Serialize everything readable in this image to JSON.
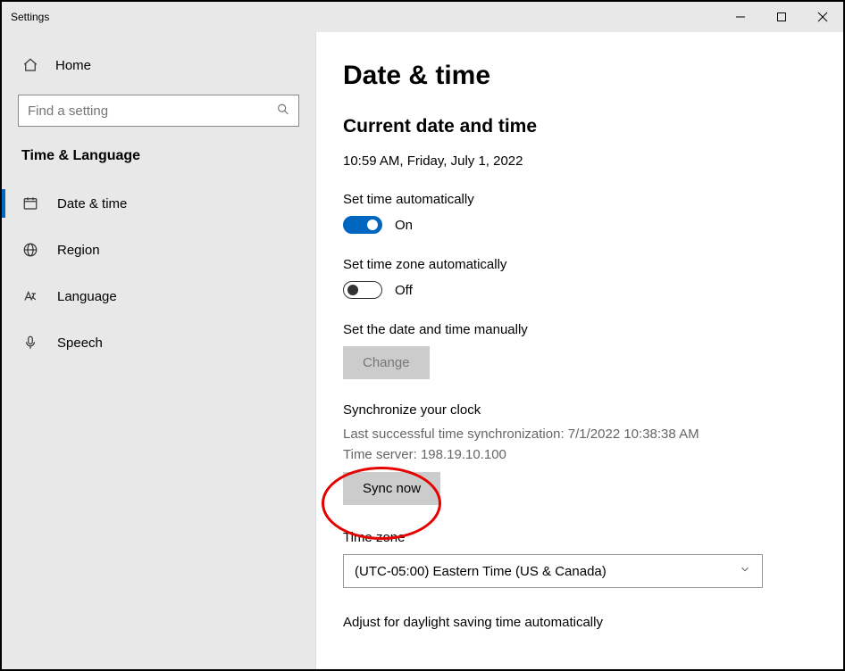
{
  "titlebar": {
    "title": "Settings"
  },
  "sidebar": {
    "home_label": "Home",
    "search_placeholder": "Find a setting",
    "section_header": "Time & Language",
    "nav": [
      {
        "id": "date-time",
        "label": "Date & time",
        "active": true
      },
      {
        "id": "region",
        "label": "Region",
        "active": false
      },
      {
        "id": "language",
        "label": "Language",
        "active": false
      },
      {
        "id": "speech",
        "label": "Speech",
        "active": false
      }
    ]
  },
  "main": {
    "page_title": "Date & time",
    "current_section_title": "Current date and time",
    "current_datetime": "10:59 AM, Friday, July 1, 2022",
    "auto_time": {
      "label": "Set time automatically",
      "state_text": "On",
      "on": true
    },
    "auto_tz": {
      "label": "Set time zone automatically",
      "state_text": "Off",
      "on": false
    },
    "manual": {
      "label": "Set the date and time manually",
      "button": "Change"
    },
    "sync": {
      "title": "Synchronize your clock",
      "last_sync_label": "Last successful time synchronization: ",
      "last_sync_value": "7/1/2022 10:38:38 AM",
      "server_label": "Time server: ",
      "server_value": "198.19.10.100",
      "button": "Sync now"
    },
    "timezone": {
      "label": "Time zone",
      "selected": "(UTC-05:00) Eastern Time (US & Canada)"
    },
    "daylight": {
      "label": "Adjust for daylight saving time automatically"
    }
  }
}
